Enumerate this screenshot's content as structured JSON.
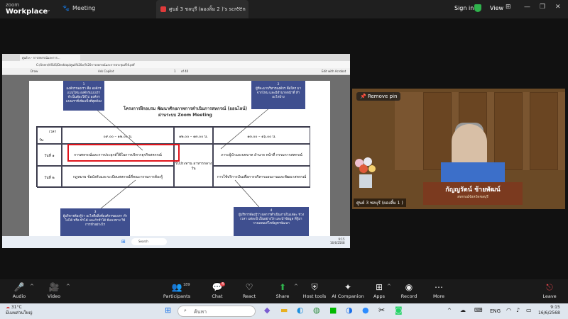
{
  "app": {
    "brand_small": "zoom",
    "brand": "Workplace",
    "meeting_label": "Meeting",
    "share_tab": "ศูนย์ 3 ชลบุรี (ผองลิ้ม 2 )'s screen",
    "sign_in": "Sign in",
    "view": "View"
  },
  "pdf": {
    "tab_title": "ศูนย์ ๓ - การสหกรณ์และการ...",
    "address": "C:/Users/ASUS/Desktop/ศูนย์%20๓/%20การสหกรณ์และการประชุมส์ให้.pdf",
    "toolbar": {
      "draw": "Draw",
      "ask_copilot": "Ask Copilot",
      "page": "1",
      "of": "of 40",
      "edit": "Edit with Acrobat"
    },
    "title_line1": "โครงการฝึกอบรม พัฒนาศักยภาพการดำเนินการสหกรณ์ (ออนไลน์)",
    "title_line2": "ผ่านระบบ Zoom Meeting",
    "table": {
      "corner_top": "เวลา",
      "corner_bottom": "วัน",
      "col1": "๐๙.๐๐ – ๑๒.๐๐ น.",
      "col2": "๑๒.๐๐ – ๑๓.๐๐ น.",
      "col3": "๑๓.๐๐ – ๑๖.๐๐ น.",
      "day1": "วันที่ ๑",
      "day2": "วันที่ ๒",
      "r1c1": "การสหกรณ์และการประยุกต์ใช้ในการบริหารธุรกิจสหกรณ์",
      "r1c3": "ภาระผู้นำและบทบาท อำนาจ หน้าที่ กรรมการสหกรณ์",
      "lunch": "รับประทาน อาหารกลางวัน",
      "r2c1": "กฎหมาย ข้อบังคับและระเบียบสหกรณ์ที่คณะกรรมการต้องรู้",
      "r2c3": "การใช้บริการเงินเพื่อการบริหารแผนงานและพัฒนาสหกรณ์"
    },
    "callouts": [
      {
        "num": "1",
        "text": "องค์กรของเรา คือ องค์กรแบบไหน องค์กรแบบเรา จำเป็นต้องให้ไป องค์กรแบบเราที่เข้มแข็งที่สุดต้อง"
      },
      {
        "num": "2",
        "text": "ผู้ที่จะมาบริหารองค์กร คือใคร มาจากไหน และมีอำนาจหน้าที่ ทำอะไรบ้าง"
      },
      {
        "num": "3",
        "text": "ผู้บริหารต้องรู้ว่า อะไรคือสิ่งที่องค์กรของเรา ทำไม่ได้ หรือ ทำได้ และถ้าทำได้ มีแนวทาง วิธีการทำอย่างไร"
      },
      {
        "num": "4",
        "text": "ผู้บริหารต้องรู้ว่า ผลการดำเนินงานในแต่ละ ช่วงเวลา แต่ละปี เป็นอย่างไร และนำข้อมูล ที่รู้มาวางแผนแก้ไขปัญหาพัฒนา"
      }
    ],
    "taskbar_search": "Search",
    "taskbar_time": "9:15",
    "taskbar_date": "16/6/2568"
  },
  "camera": {
    "remove_pin": "Remove pin",
    "participant": "ศูนย์ 3 ชลบุรี (ผองลิ้ม 1 )",
    "nameplate_name": "กัญญรัตน์ ช้ายพัฒน์",
    "nameplate_org": "สหกรณ์จังหวัดชลบุรี"
  },
  "toolbar": {
    "audio": "Audio",
    "video": "Video",
    "participants": "Participants",
    "participants_count": "189",
    "chat": "Chat",
    "chat_badge": "4",
    "react": "React",
    "share": "Share",
    "host_tools": "Host tools",
    "ai_companion": "AI Companion",
    "apps": "Apps",
    "record": "Record",
    "more": "More",
    "leave": "Leave"
  },
  "taskbar": {
    "temp": "31°C",
    "weather": "มีเมฆส่วนใหญ่",
    "search": "ค้นหา",
    "lang": "ENG",
    "time": "9:15",
    "date": "16/6/2568",
    "badge": "4"
  },
  "colors": {
    "accent_red": "#e0141c",
    "callout_blue": "#3f4f8f",
    "zoom_green": "#2fb24c"
  }
}
